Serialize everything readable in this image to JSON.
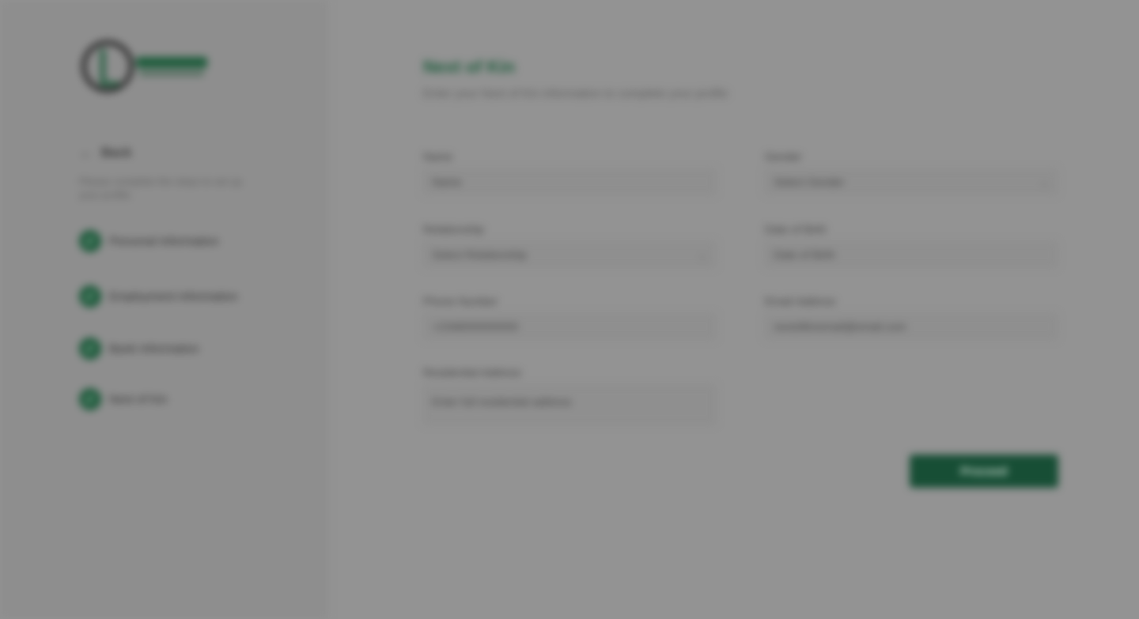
{
  "sidebar": {
    "back_label": "Back",
    "description": "Please complete the steps to set up your profile.",
    "steps": [
      {
        "number": "✓",
        "label": "Personal Information"
      },
      {
        "number": "✓",
        "label": "Employment Information"
      },
      {
        "number": "✓",
        "label": "Bank Information"
      },
      {
        "number": "✓",
        "label": "Next of Kin"
      }
    ]
  },
  "main": {
    "title": "Next of Kin",
    "subtitle": "Enter your Next of Kin information to complete your profile",
    "fields": {
      "name": {
        "label": "Name",
        "value": "Name"
      },
      "gender": {
        "label": "Gender",
        "value": "Select Gender"
      },
      "relationship": {
        "label": "Relationship",
        "value": "Select Relationship"
      },
      "date_of_birth": {
        "label": "Date of Birth",
        "value": "Date of Birth"
      },
      "phone": {
        "label": "Phone Number",
        "value": "+2348000000000"
      },
      "email": {
        "label": "Email Address",
        "value": "nextofkinemail@email.com"
      },
      "residential_address": {
        "label": "Residential Address",
        "value": "Enter full residential address"
      }
    },
    "proceed_label": "Proceed"
  },
  "colors": {
    "accent": "#1d5a3b",
    "overlay": "#939393"
  },
  "icons": {
    "back": "arrow-left-icon",
    "step": "check-icon",
    "dropdown": "chevron-down-icon"
  }
}
